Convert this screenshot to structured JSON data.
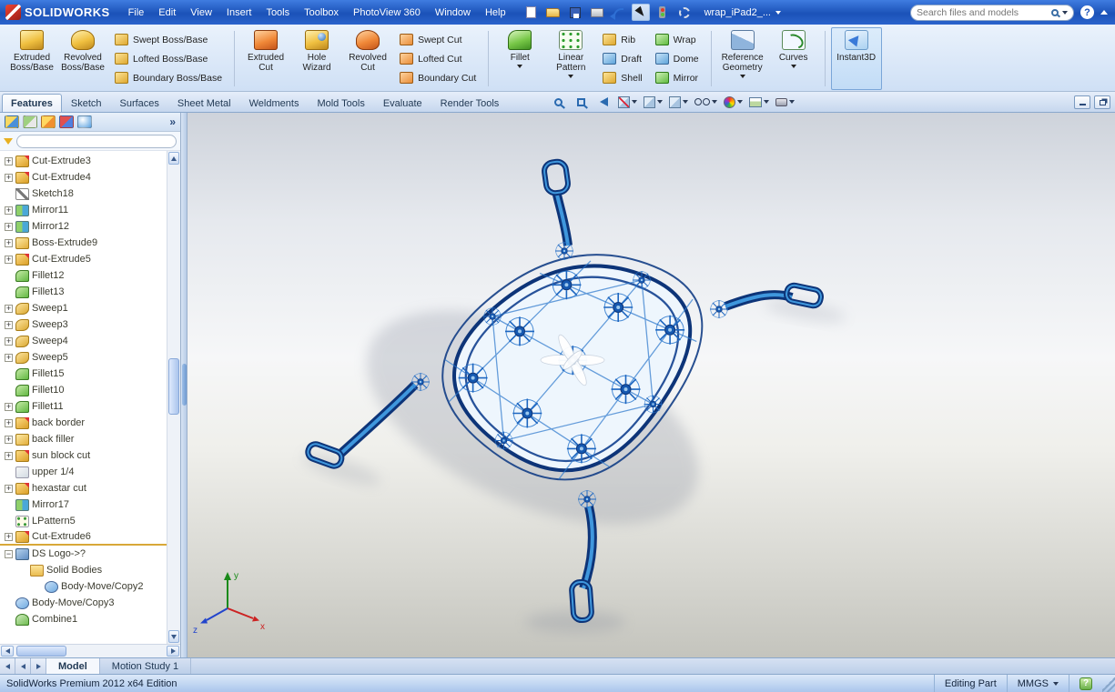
{
  "titlebar": {
    "logo": "SOLIDWORKS",
    "menus": [
      "File",
      "Edit",
      "View",
      "Insert",
      "Tools",
      "Toolbox",
      "PhotoView 360",
      "Window",
      "Help"
    ],
    "document": "wrap_iPad2_...",
    "search_placeholder": "Search files and models"
  },
  "icons": {
    "help": "?",
    "panel_chevrons": "»",
    "status_help": "?"
  },
  "ribbon": {
    "extruded_boss": [
      "Extruded",
      "Boss/Base"
    ],
    "revolved_boss": [
      "Revolved",
      "Boss/Base"
    ],
    "boss_small": [
      {
        "label": "Swept Boss/Base",
        "icon": "sgold"
      },
      {
        "label": "Lofted Boss/Base",
        "icon": "sgold"
      },
      {
        "label": "Boundary Boss/Base",
        "icon": "sgold"
      }
    ],
    "extruded_cut": [
      "Extruded",
      "Cut"
    ],
    "hole_wizard": [
      "Hole",
      "Wizard"
    ],
    "revolved_cut": [
      "Revolved",
      "Cut"
    ],
    "cut_small": [
      {
        "label": "Swept Cut",
        "icon": "sorange"
      },
      {
        "label": "Lofted Cut",
        "icon": "sorange"
      },
      {
        "label": "Boundary Cut",
        "icon": "sorange"
      }
    ],
    "fillet": "Fillet",
    "linear_pattern": [
      "Linear",
      "Pattern"
    ],
    "feat_small1": [
      {
        "label": "Rib",
        "icon": "sgold"
      },
      {
        "label": "Draft",
        "icon": "sblue"
      },
      {
        "label": "Shell",
        "icon": "sgold"
      }
    ],
    "feat_small2": [
      {
        "label": "Wrap",
        "icon": "sgreen"
      },
      {
        "label": "Dome",
        "icon": "sblue"
      },
      {
        "label": "Mirror",
        "icon": "sgreen"
      }
    ],
    "reference_geometry": [
      "Reference",
      "Geometry"
    ],
    "curves": "Curves",
    "instant3d": "Instant3D"
  },
  "tabs": [
    {
      "label": "Features",
      "cls": "active"
    },
    {
      "label": "Sketch"
    },
    {
      "label": "Surfaces"
    },
    {
      "label": "Sheet Metal"
    },
    {
      "label": "Weldments"
    },
    {
      "label": "Mold Tools"
    },
    {
      "label": "Evaluate"
    },
    {
      "label": "Render Tools"
    }
  ],
  "tree": {
    "items": [
      {
        "label": "Cut-Extrude3",
        "icon": "cut",
        "exp": "+"
      },
      {
        "label": "Cut-Extrude4",
        "icon": "cut",
        "exp": "+"
      },
      {
        "label": "Sketch18",
        "icon": "sketch",
        "exp": ""
      },
      {
        "label": "Mirror11",
        "icon": "mirror",
        "exp": "+"
      },
      {
        "label": "Mirror12",
        "icon": "mirror",
        "exp": "+"
      },
      {
        "label": "Boss-Extrude9",
        "icon": "boss",
        "exp": "+"
      },
      {
        "label": "Cut-Extrude5",
        "icon": "cut",
        "exp": "+"
      },
      {
        "label": "Fillet12",
        "icon": "fillet",
        "exp": ""
      },
      {
        "label": "Fillet13",
        "icon": "fillet",
        "exp": ""
      },
      {
        "label": "Sweep1",
        "icon": "sweep",
        "exp": "+"
      },
      {
        "label": "Sweep3",
        "icon": "sweep",
        "exp": "+"
      },
      {
        "label": "Sweep4",
        "icon": "sweep",
        "exp": "+"
      },
      {
        "label": "Sweep5",
        "icon": "sweep",
        "exp": "+"
      },
      {
        "label": "Fillet15",
        "icon": "fillet",
        "exp": ""
      },
      {
        "label": "Fillet10",
        "icon": "fillet",
        "exp": ""
      },
      {
        "label": "Fillet11",
        "icon": "fillet",
        "exp": "+"
      },
      {
        "label": "back border",
        "icon": "cut",
        "exp": "+"
      },
      {
        "label": "back filler",
        "icon": "boss",
        "exp": "+"
      },
      {
        "label": "sun block cut",
        "icon": "cut",
        "exp": "+"
      },
      {
        "label": "upper 1/4",
        "icon": "plain",
        "exp": ""
      },
      {
        "label": "hexastar cut",
        "icon": "cut",
        "exp": "+"
      },
      {
        "label": "Mirror17",
        "icon": "mirror",
        "exp": ""
      },
      {
        "label": "LPattern5",
        "icon": "pattern",
        "exp": ""
      },
      {
        "label": "Cut-Extrude6",
        "icon": "cut",
        "exp": "+",
        "cls": "rollback"
      },
      {
        "label": "DS Logo->?",
        "icon": "logo",
        "exp": "−"
      },
      {
        "label": "Solid Bodies",
        "icon": "folder",
        "exp": "",
        "cls": "ind1"
      },
      {
        "label": "Body-Move/Copy2",
        "icon": "move",
        "exp": "",
        "cls": "ind2"
      },
      {
        "label": "Body-Move/Copy3",
        "icon": "move",
        "exp": ""
      },
      {
        "label": "Combine1",
        "icon": "combine",
        "exp": ""
      }
    ]
  },
  "triad": {
    "x": "x",
    "y": "y",
    "z": "z"
  },
  "bottom": {
    "tabs": [
      {
        "label": "Model",
        "cls": "active"
      },
      {
        "label": "Motion Study 1"
      }
    ]
  },
  "statusbar": {
    "edition": "SolidWorks Premium 2012 x64 Edition",
    "mode": "Editing Part",
    "units": "MMGS"
  }
}
